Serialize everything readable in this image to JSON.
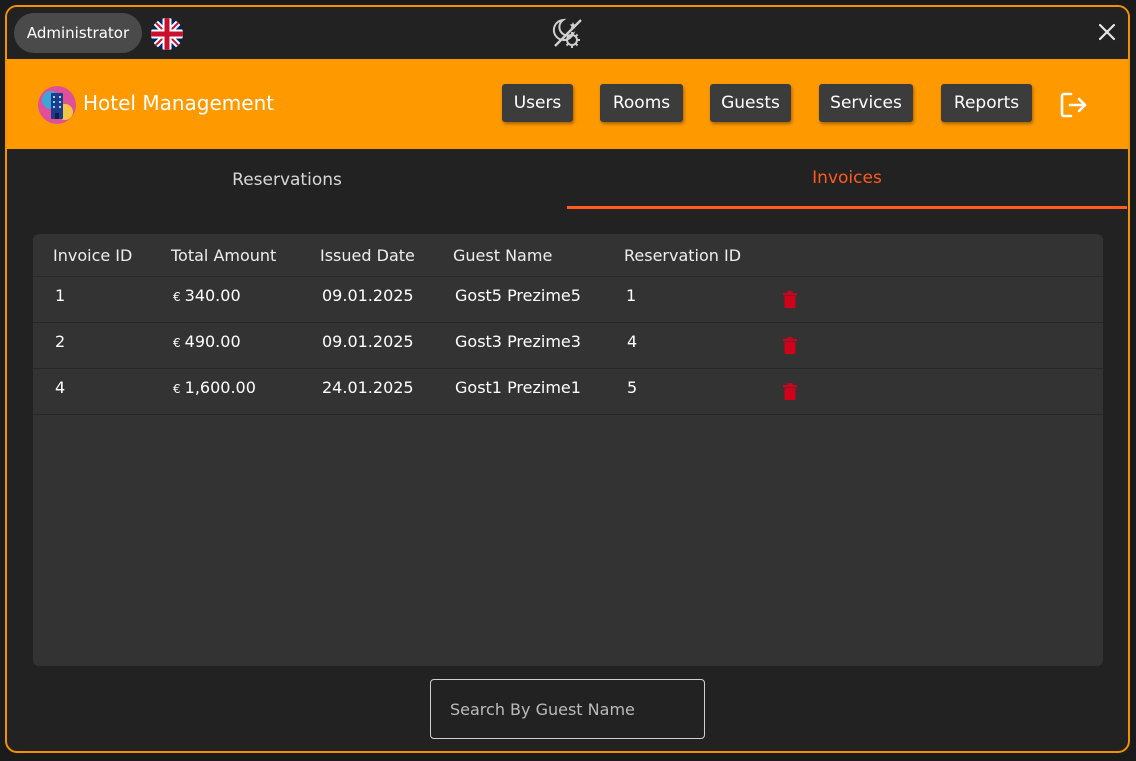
{
  "topbar": {
    "role": "Administrator"
  },
  "header": {
    "title": "Hotel Management",
    "nav": [
      "Users",
      "Rooms",
      "Guests",
      "Services",
      "Reports"
    ]
  },
  "tabs": {
    "reservations": "Reservations",
    "invoices": "Invoices",
    "active": "Invoices"
  },
  "table": {
    "columns": [
      "Invoice ID",
      "Total Amount",
      "Issued Date",
      "Guest Name",
      "Reservation ID"
    ],
    "currency_symbol": "€",
    "rows": [
      {
        "invoice_id": "1",
        "amount": "340.00",
        "date": "09.01.2025",
        "guest": "Gost5 Prezime5",
        "reservation_id": "1"
      },
      {
        "invoice_id": "2",
        "amount": "490.00",
        "date": "09.01.2025",
        "guest": "Gost3 Prezime3",
        "reservation_id": "4"
      },
      {
        "invoice_id": "4",
        "amount": "1,600.00",
        "date": "24.01.2025",
        "guest": "Gost1 Prezime1",
        "reservation_id": "5"
      }
    ]
  },
  "search": {
    "placeholder": "Search By Guest Name",
    "value": ""
  },
  "colors": {
    "accent": "#ff9900",
    "active_tab": "#ff5a1f",
    "delete": "#d0021b",
    "background": "#222222"
  },
  "icons": [
    "uk-flag-icon",
    "theme-toggle-icon",
    "close-icon",
    "hotel-logo-icon",
    "logout-icon",
    "trash-icon"
  ]
}
